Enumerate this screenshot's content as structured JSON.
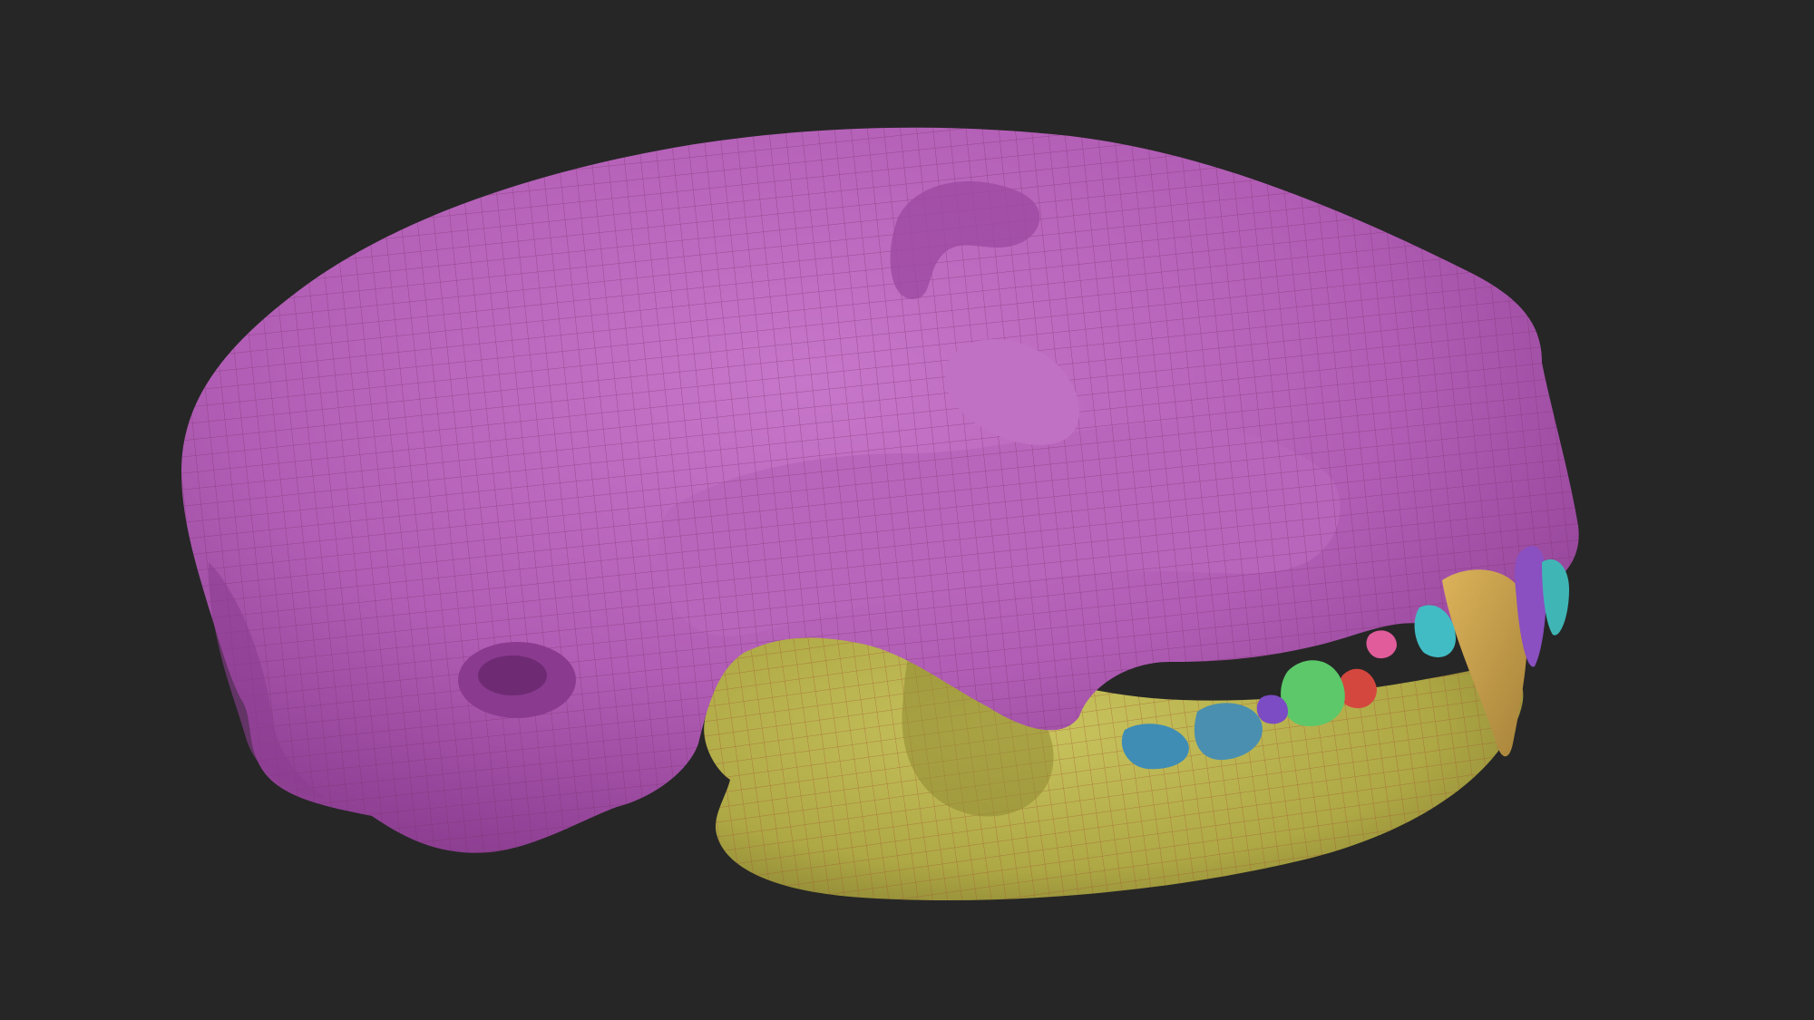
{
  "viewport": {
    "background": "#262626"
  },
  "model": {
    "parts": [
      {
        "name": "cranium",
        "color": "#b15db5"
      },
      {
        "name": "mandible",
        "color": "#b3ae4c"
      },
      {
        "name": "upper-canine",
        "color": "#c7a34c"
      },
      {
        "name": "incisors",
        "color": "#8a4fc0"
      },
      {
        "name": "molars",
        "color": "#4a8fb0"
      },
      {
        "name": "premolars",
        "color": "#5cc86a"
      }
    ],
    "wireframe_color": "#7a2a4a"
  }
}
